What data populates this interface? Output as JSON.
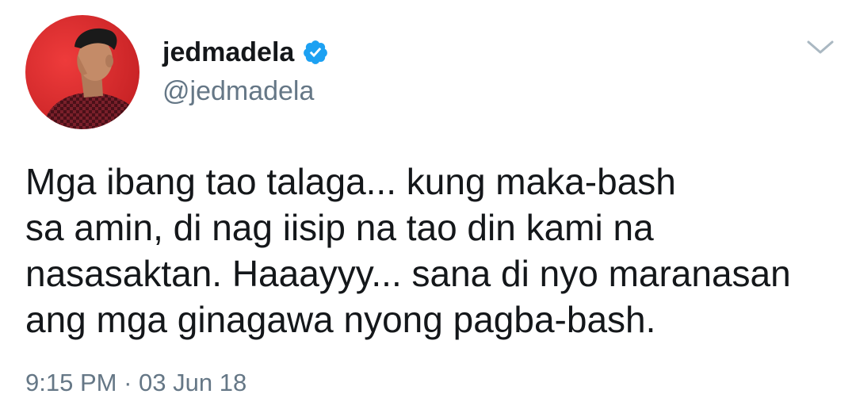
{
  "author": {
    "display_name": "jedmadela",
    "handle": "@jedmadela",
    "verified": true,
    "avatar_icon": "profile-photo",
    "verified_icon": "verified-badge-icon"
  },
  "tweet": {
    "lines": [
      "Mga ibang tao talaga... kung maka-bash",
      "sa amin, di nag iisip na tao din kami na",
      "nasasaktan. Haaayyy... sana di nyo maranasan",
      "ang mga ginagawa nyong pagba-bash."
    ],
    "time": "9:15 PM",
    "separator": "·",
    "date": "03 Jun 18"
  },
  "menu": {
    "icon": "chevron-down-icon"
  },
  "colors": {
    "text_primary": "#14171a",
    "text_secondary": "#657786",
    "verified_blue": "#1da1f2",
    "chevron": "#aab8c2",
    "avatar_background": "#d42a2a"
  }
}
